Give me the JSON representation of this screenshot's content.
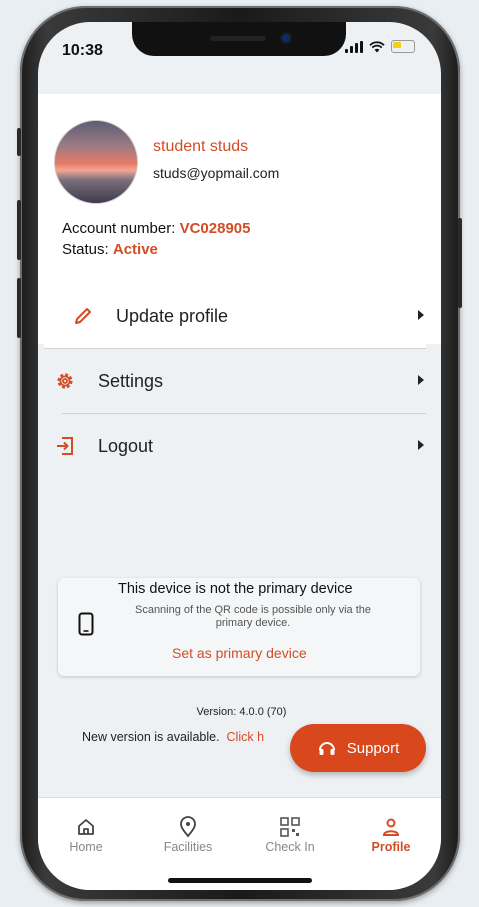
{
  "status_bar": {
    "time": "10:38"
  },
  "profile": {
    "name": "student studs",
    "email": "studs@yopmail.com",
    "account_label": "Account number:",
    "account_number": "VC028905",
    "status_label": "Status:",
    "status_value": "Active"
  },
  "menu": [
    {
      "label": "Update profile",
      "icon": "pencil-icon"
    },
    {
      "label": "Settings",
      "icon": "gear-icon"
    },
    {
      "label": "Logout",
      "icon": "logout-icon"
    }
  ],
  "device_notice": {
    "title": "This device is not the primary device",
    "subtitle": "Scanning of the QR code is possible only via the primary device.",
    "action": "Set as primary device"
  },
  "version": {
    "text": "Version: 4.0.0 (70)",
    "update_text": "New version is available.",
    "update_link": "Click h"
  },
  "support": {
    "label": "Support"
  },
  "tabs": [
    {
      "label": "Home",
      "icon": "home-icon"
    },
    {
      "label": "Facilities",
      "icon": "location-pin-icon"
    },
    {
      "label": "Check In",
      "icon": "qr-code-icon"
    },
    {
      "label": "Profile",
      "icon": "user-icon",
      "active": true
    }
  ],
  "colors": {
    "accent": "#d24d26",
    "button": "#d9471d",
    "background": "#edf1f4"
  }
}
